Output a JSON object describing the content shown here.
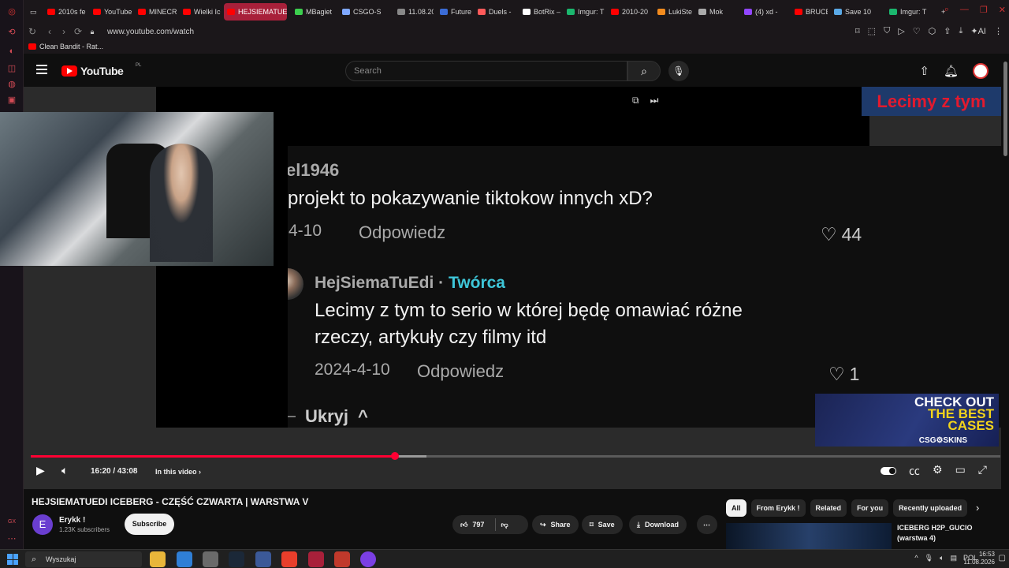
{
  "browser": {
    "tabs": [
      {
        "label": "2010s fe",
        "color": "#ff0000"
      },
      {
        "label": "YouTube",
        "color": "#ff0000"
      },
      {
        "label": "MINECR",
        "color": "#ff0000"
      },
      {
        "label": "Wielki Ic",
        "color": "#ff0000"
      },
      {
        "label": "HEJSIEMATUEI",
        "color": "#ff0000"
      },
      {
        "label": "MBagiet",
        "color": "#3ccf4e"
      },
      {
        "label": "CSGO-S",
        "color": "#7fa8ff"
      },
      {
        "label": "11.08.20",
        "color": "#888888"
      },
      {
        "label": "Future e",
        "color": "#3b6cd6"
      },
      {
        "label": "Duels -",
        "color": "#ff5a5a"
      },
      {
        "label": "BotRix –",
        "color": "#ffffff"
      },
      {
        "label": "Imgur: T",
        "color": "#1bb76e"
      },
      {
        "label": "2010-20",
        "color": "#ff0000"
      },
      {
        "label": "LukiStev",
        "color": "#f28b1e"
      },
      {
        "label": "Mok",
        "color": "#aaaaaa"
      },
      {
        "label": "(4) xd -",
        "color": "#9146ff"
      },
      {
        "label": "BRUCE V",
        "color": "#ff0000"
      },
      {
        "label": "Save 10",
        "color": "#5aa9e6"
      },
      {
        "label": "Imgur: T",
        "color": "#1bb76e"
      }
    ],
    "url": "www.youtube.com/watch",
    "bookmark": "Clean Bandit - Rat..."
  },
  "youtube": {
    "logo": "YouTube",
    "region": "PL",
    "search_placeholder": "Search"
  },
  "video": {
    "banner": "Lecimy z tym",
    "comment1_user": "el1946",
    "comment1_text": "projekt to pokazywanie tiktokow innych xD?",
    "comment1_date": "-4-10",
    "comment1_reply": "Odpowiedz",
    "comment1_likes": "44",
    "comment2_user": "HejSiemaTuEdi",
    "comment2_sep": "·",
    "comment2_badge": "Twórca",
    "comment2_text_line1": "Lecimy z tym to serio w której będę omawiać różne",
    "comment2_text_line2": "rzeczy, artykuły czy filmy itd",
    "comment2_date": "2024-4-10",
    "comment2_reply": "Odpowiedz",
    "comment2_likes": "1",
    "hide_label": "Ukryj",
    "ad_line1": "CHECK OUT",
    "ad_line2": "THE BEST",
    "ad_line3": "CASES",
    "ad_brand": "CSG⚙SKINS",
    "time": "16:20 / 43:08",
    "in_this_video": "In this video",
    "progress_played": 0.376,
    "progress_buffered": 0.408
  },
  "below": {
    "title": "HEJSIEMATUEDI ICEBERG - CZĘŚĆ CZWARTA | WARSTWA V",
    "channel_initial": "E",
    "channel": "Erykk !",
    "subscribers": "1.23K subscribers",
    "subscribe": "Subscribe",
    "likes": "797",
    "share": "Share",
    "save": "Save",
    "download": "Download",
    "chips": [
      "All",
      "From Erykk !",
      "Related",
      "For you",
      "Recently uploaded"
    ],
    "related_title_line1": "ICEBERG H2P_GUCIO",
    "related_title_line2": "(warstwa 4)"
  },
  "taskbar": {
    "search": "Wyszukaj",
    "lang": "POL",
    "time": "16:53",
    "date": "11.08.2026"
  }
}
